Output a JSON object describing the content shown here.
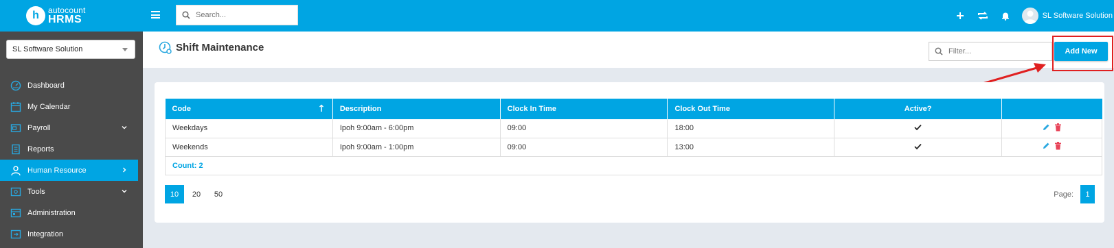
{
  "app": {
    "logo_letter": "h",
    "logo_top": "autocount",
    "logo_bottom": "HRMS"
  },
  "sidebar": {
    "company": "SL Software Solution",
    "items": [
      {
        "label": "Dashboard",
        "icon": "gauge-icon",
        "chevron": false
      },
      {
        "label": "My Calendar",
        "icon": "calendar-icon",
        "chevron": false
      },
      {
        "label": "Payroll",
        "icon": "payroll-icon",
        "chevron": true
      },
      {
        "label": "Reports",
        "icon": "report-icon",
        "chevron": false
      },
      {
        "label": "Human Resource",
        "icon": "person-icon",
        "chevron": true,
        "active": true
      },
      {
        "label": "Tools",
        "icon": "tools-icon",
        "chevron": true
      },
      {
        "label": "Administration",
        "icon": "admin-icon",
        "chevron": false
      },
      {
        "label": "Integration",
        "icon": "integration-icon",
        "chevron": false
      }
    ]
  },
  "topbar": {
    "search_placeholder": "Search...",
    "user_name": "SL Software Solution"
  },
  "page": {
    "title": "Shift Maintenance",
    "filter_placeholder": "Filter...",
    "add_new_label": "Add New"
  },
  "table": {
    "columns": [
      "Code",
      "Description",
      "Clock In Time",
      "Clock Out Time",
      "Active?",
      ""
    ],
    "rows": [
      {
        "code": "Weekdays",
        "description": "Ipoh 9:00am - 6:00pm",
        "clock_in": "09:00",
        "clock_out": "18:00",
        "active": true
      },
      {
        "code": "Weekends",
        "description": "Ipoh 9:00am - 1:00pm",
        "clock_in": "09:00",
        "clock_out": "13:00",
        "active": true
      }
    ],
    "count_label": "Count: 2"
  },
  "pager": {
    "sizes": [
      "10",
      "20",
      "50"
    ],
    "active_size": "10",
    "page_label": "Page:",
    "current_page": "1"
  },
  "colors": {
    "accent": "#00a5e3",
    "sidebar_bg": "#4a4a4a",
    "highlight": "#e02020",
    "delete": "#e8455a"
  }
}
